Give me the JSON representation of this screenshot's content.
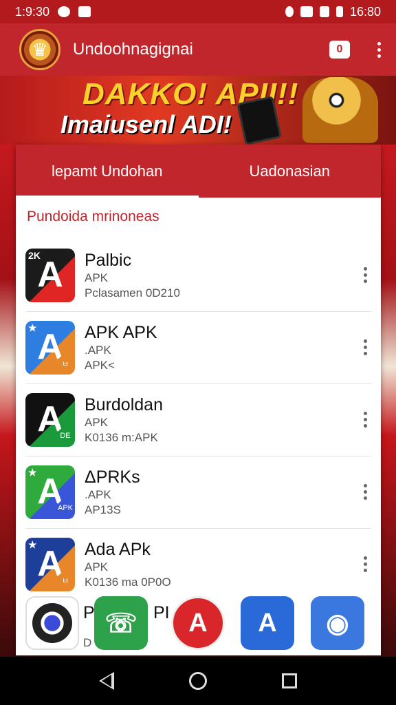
{
  "status_bar": {
    "left_time": "1:9:30",
    "right_time": "16:80"
  },
  "app_bar": {
    "title": "Undoohnagignai",
    "camera_label": "0"
  },
  "banner": {
    "line1": "DAKKO! APII!!",
    "line2": "Imaiusenl ADI!"
  },
  "tabs": [
    {
      "label": "lepamt Undohan",
      "active": true
    },
    {
      "label": "Uadonasian",
      "active": false
    }
  ],
  "section_title": "Pundoida mrinoneas",
  "apps": [
    {
      "name": "Palbic",
      "line2": "APK",
      "line3": "Pclasamen 0D210",
      "icon_bg": "#1b1b1b",
      "icon_accent": "#e02525",
      "icon_tag": "2K",
      "glyph": "A",
      "badge": ""
    },
    {
      "name": "APK APK",
      "line2": ".APK",
      "line3": "APK<",
      "icon_bg": "#2e7de0",
      "icon_accent": "#e8862a",
      "icon_tag": "★",
      "glyph": "A",
      "badge": "ㅂ"
    },
    {
      "name": "Burdoldan",
      "line2": "APK",
      "line3": "K0136  m:APK",
      "icon_bg": "#111111",
      "icon_accent": "#1a9a3a",
      "icon_tag": "",
      "glyph": "A",
      "badge": "DE"
    },
    {
      "name": "ΔPRKs",
      "line2": ".APK",
      "line3": "AP13S",
      "icon_bg": "#2faa3c",
      "icon_accent": "#3a56d8",
      "icon_tag": "★",
      "glyph": "A",
      "badge": "APK"
    },
    {
      "name": "Ada APk",
      "line2": "APK",
      "line3": "K0136  ma 0P0O",
      "icon_bg": "#1d3f9a",
      "icon_accent": "#e8862a",
      "icon_tag": "★",
      "glyph": "A",
      "badge": "ㅂ"
    }
  ],
  "dock": [
    {
      "color": "#2b2b2b",
      "glyph": "◎"
    },
    {
      "color": "#2ea24a",
      "glyph": "☏"
    },
    {
      "color": "#d8262b",
      "glyph": "A"
    },
    {
      "color": "#2a6ad8",
      "glyph": "A"
    },
    {
      "color": "#3a78e0",
      "glyph": "◉"
    }
  ],
  "partial_row": {
    "name": "P",
    "suffix": "PI",
    "line2": "D"
  }
}
